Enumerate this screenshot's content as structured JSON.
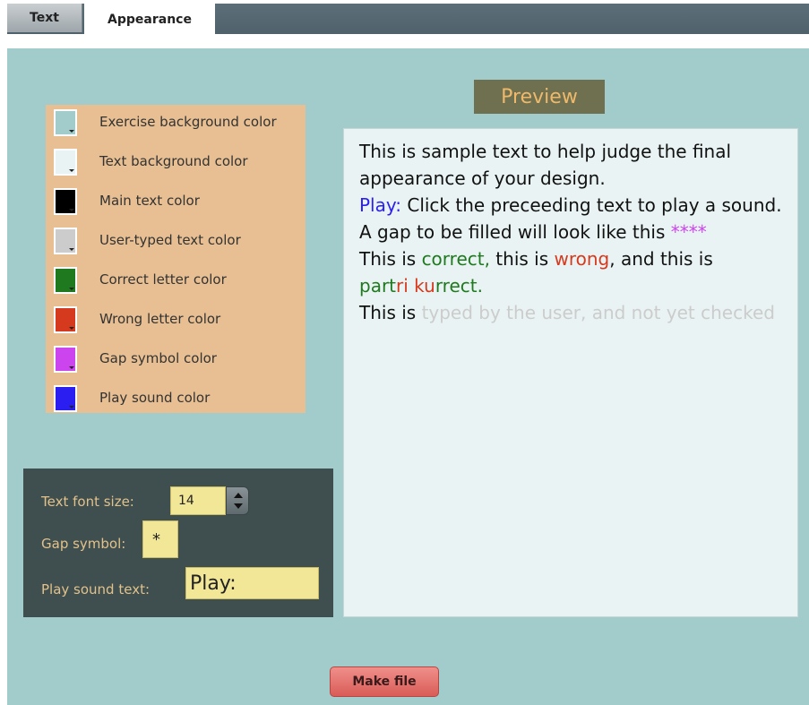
{
  "tabs": [
    {
      "label": "Text"
    },
    {
      "label": "Appearance"
    }
  ],
  "colors": {
    "items": [
      {
        "label": "Exercise background color",
        "color": "#a2cbcb"
      },
      {
        "label": "Text background color",
        "color": "#e9f3f3"
      },
      {
        "label": "Main text color",
        "color": "#000000"
      },
      {
        "label": "User-typed text color",
        "color": "#cccccc"
      },
      {
        "label": "Correct letter color",
        "color": "#1f7a1f"
      },
      {
        "label": "Wrong letter color",
        "color": "#d63a1e"
      },
      {
        "label": "Gap symbol color",
        "color": "#cc44ee"
      },
      {
        "label": "Play sound color",
        "color": "#2a1ff0"
      }
    ]
  },
  "settings": {
    "font_size_label": "Text font size:",
    "font_size_value": "14",
    "gap_symbol_label": "Gap symbol:",
    "gap_symbol_value": "*",
    "play_text_label": "Play sound text:",
    "play_text_value": "Play:"
  },
  "preview": {
    "title": "Preview",
    "line1": "This is sample text to help judge the final appearance of your design.",
    "play_word": "Play:",
    "play_rest": " Click the preceeding text to play a sound.",
    "gap_text": "A gap to be filled will look like this ",
    "gap_stars": "****",
    "correct_prefix": "This is ",
    "correct_word": "correct,",
    "middle": " this is ",
    "wrong_word": "wrong",
    "end": ", and this is",
    "part_a": "part",
    "part_b": "ri",
    "part_c": " ",
    "part_d": "ku",
    "part_e": "rrect.",
    "typed_prefix": "This is ",
    "typed_text": "typed by the user, and not yet checked"
  },
  "actions": {
    "make_file": "Make file"
  }
}
